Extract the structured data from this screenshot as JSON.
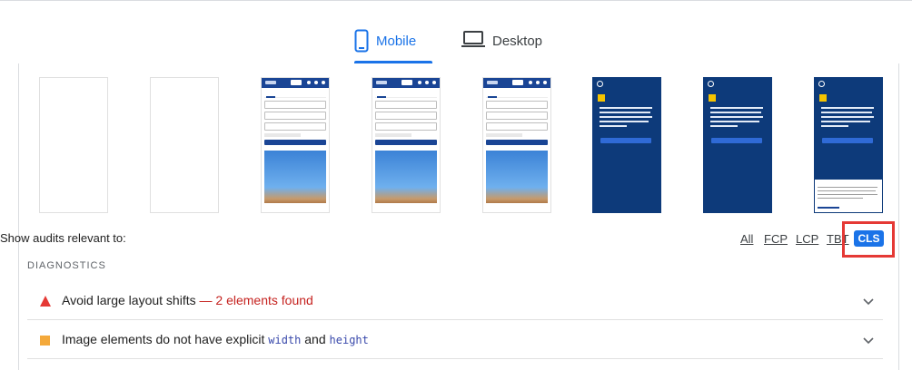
{
  "tabs": [
    {
      "label": "Mobile",
      "icon": "phone-icon",
      "active": true
    },
    {
      "label": "Desktop",
      "icon": "laptop-icon",
      "active": false
    }
  ],
  "filmstrip": {
    "promo_text": "Travelocity is part of the Expedia brand, download the app to earn rewards and save up to 25% on select hotels"
  },
  "filter": {
    "label": "Show audits relevant to:",
    "options": [
      "All",
      "FCP",
      "LCP",
      "TBT",
      "CLS"
    ],
    "selected": "CLS"
  },
  "diagnostics": {
    "title": "DIAGNOSTICS",
    "audits": [
      {
        "title": "Avoid large layout shifts",
        "detail": "— 2 elements found",
        "severity": "fail",
        "icon": "warning-triangle-icon"
      },
      {
        "title_pre": "Image elements do not have explicit ",
        "code1": "width",
        "mid": " and ",
        "code2": "height",
        "severity": "average",
        "icon": "average-square-icon"
      }
    ]
  },
  "colors": {
    "accent": "#1a73e8",
    "fail": "#e53935",
    "average": "#f4a93b",
    "highlight_box": "#e53935"
  }
}
